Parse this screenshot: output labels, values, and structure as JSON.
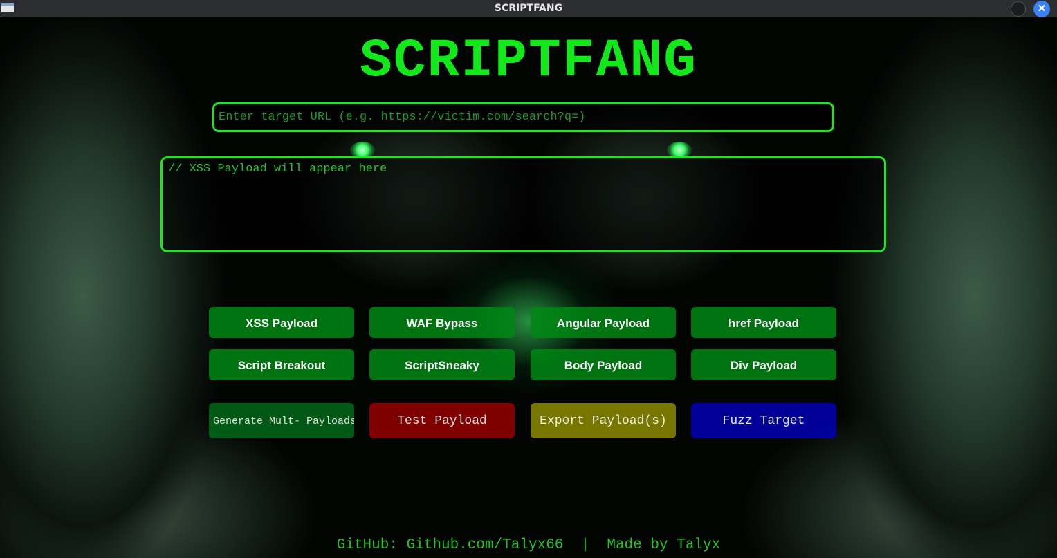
{
  "window": {
    "title": "SCRIPTFANG"
  },
  "header": {
    "app_title": "SCRIPTFANG"
  },
  "url_input": {
    "placeholder": "Enter target URL (e.g. https://victim.com/search?q=)"
  },
  "payload_output": {
    "placeholder": "// XSS Payload will appear here"
  },
  "payload_buttons": [
    "XSS Payload",
    "WAF Bypass",
    "Angular Payload",
    "href Payload",
    "Script Breakout",
    "ScriptSneaky",
    "Body Payload",
    "Div Payload"
  ],
  "action_buttons": {
    "generate_multi": "Generate Mult- Payloads",
    "test": "Test Payload",
    "export": "Export Payload(s)",
    "fuzz": "Fuzz Target"
  },
  "footer": {
    "text": "GitHub: Github.com/Talyx66  |  Made by Talyx"
  },
  "colors": {
    "accent": "#12e81a",
    "test": "#960000",
    "export": "#8c8c00",
    "fuzz": "#0000b4"
  }
}
